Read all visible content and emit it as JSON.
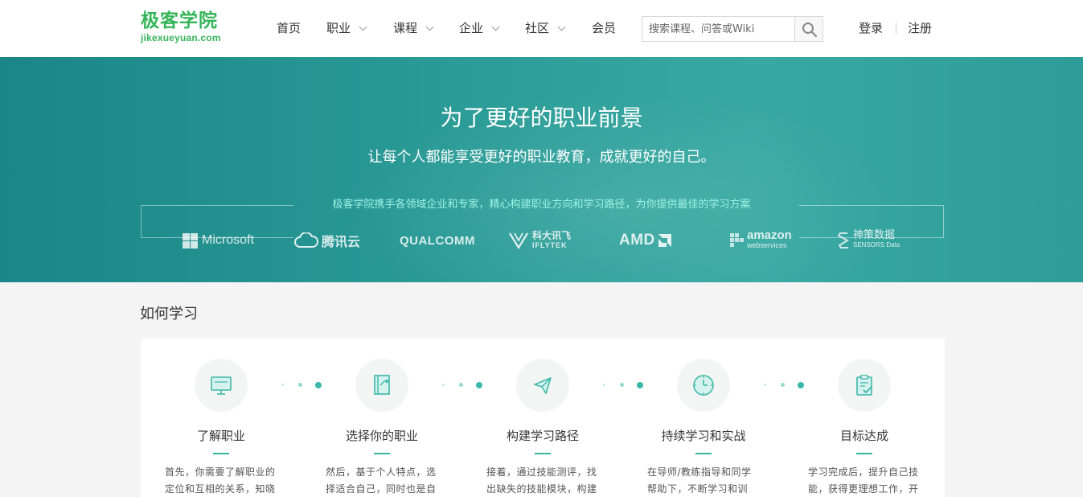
{
  "logo": {
    "cn": "极客学院",
    "en": "jikexueyuan.com"
  },
  "nav": [
    {
      "label": "首页",
      "dropdown": false
    },
    {
      "label": "职业",
      "dropdown": true
    },
    {
      "label": "课程",
      "dropdown": true
    },
    {
      "label": "企业",
      "dropdown": true
    },
    {
      "label": "社区",
      "dropdown": true
    },
    {
      "label": "会员",
      "dropdown": false
    }
  ],
  "search": {
    "placeholder": "搜索课程、问答或Wiki",
    "icon": "search-icon"
  },
  "auth": {
    "login": "登录",
    "register": "注册"
  },
  "banner": {
    "title": "为了更好的职业前景",
    "subtitle": "让每个人都能享受更好的职业教育，成就更好的自己。",
    "partners_caption": "极客学院携手各领域企业和专家，精心构建职业方向和学习路径，为你提供最佳的学习方案",
    "partners": [
      {
        "name": "Microsoft",
        "text": "Microsoft"
      },
      {
        "name": "tencent-cloud",
        "text": "腾讯云"
      },
      {
        "name": "qualcomm",
        "text": "QUALCOMM"
      },
      {
        "name": "iflytek",
        "text": "科大讯飞",
        "sub": "IFLYTEK"
      },
      {
        "name": "amd",
        "text": "AMD"
      },
      {
        "name": "amazon-web-services",
        "text": "amazon",
        "sub": "webservices"
      },
      {
        "name": "sensors-data",
        "text": "神策数据",
        "sub": "SENSORS Data"
      }
    ]
  },
  "how_to_learn": {
    "title": "如何学习",
    "steps": [
      {
        "title": "了解职业",
        "icon": "monitor-icon",
        "desc": "首先，你需要了解职业的定位和互相的关系，知晓"
      },
      {
        "title": "选择你的职业",
        "icon": "book-icon",
        "desc": "然后，基于个人特点，选择适合自己，同时也是自"
      },
      {
        "title": "构建学习路径",
        "icon": "paper-plane-icon",
        "desc": "接着，通过技能测评，找出缺失的技能模块，构建"
      },
      {
        "title": "持续学习和实战",
        "icon": "clock-icon",
        "desc": "在导师/教练指导和同学帮助下，不断学习和训练，"
      },
      {
        "title": "目标达成",
        "icon": "clipboard-check-icon",
        "desc": "学习完成后，提升自己技能，获得更理想工作，开"
      }
    ]
  },
  "colors": {
    "brand_green": "#35b558",
    "banner_teal": "#2a9a96",
    "accent_teal": "#3db8a8"
  }
}
